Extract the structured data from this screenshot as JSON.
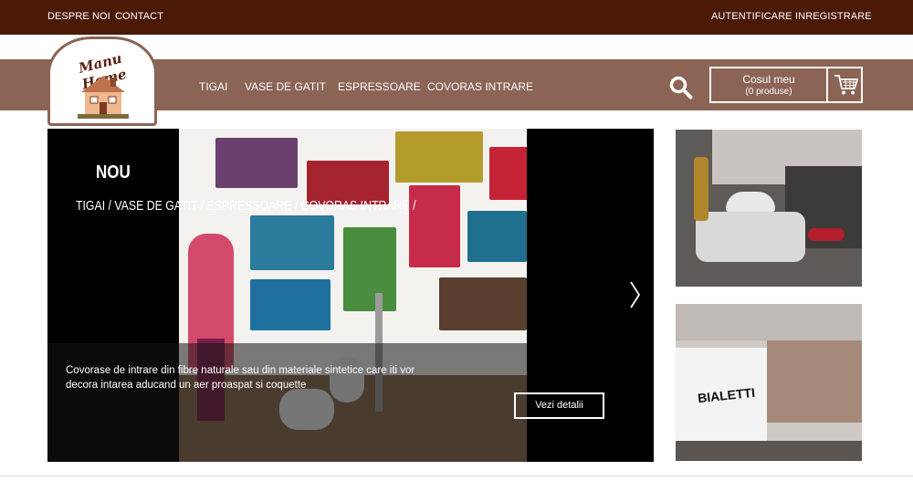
{
  "topbar": {
    "left_links": [
      "DESPRE NOI",
      "CONTACT"
    ],
    "right_links": [
      "AUTENTIFICARE",
      "INREGISTRARE"
    ]
  },
  "logo": {
    "text": "Manu Home"
  },
  "nav": {
    "items": [
      "TIGAI",
      "VASE DE GATIT",
      "ESPRESSOARE",
      "COVORAS INTRARE"
    ]
  },
  "search": {
    "icon": "search-icon"
  },
  "cart": {
    "title": "Cosul meu",
    "count": "(0 produse)",
    "icon": "cart-icon"
  },
  "slider": {
    "title": "NOU",
    "breadcrumbs": "TIGAI  / VASE DE GATIT  / ESPRESSOARE  / COVORAS INTRARE  /",
    "description": "Covorase de intrare din fibre naturale sau din materiale sintetice care iti vor decora intarea aducand un aer proaspat si coquette",
    "button": "Vezi detalii",
    "next_icon": "chevron-right-icon"
  },
  "side_banners": {
    "first": {
      "subject": "cookware-pot-image"
    },
    "second": {
      "subject": "bialetti-store-image",
      "sign_text": "BIALETTI"
    }
  },
  "colors": {
    "topbar": "#4a1a06",
    "navbar": "#8b6455",
    "accent_white": "#ffffff"
  }
}
